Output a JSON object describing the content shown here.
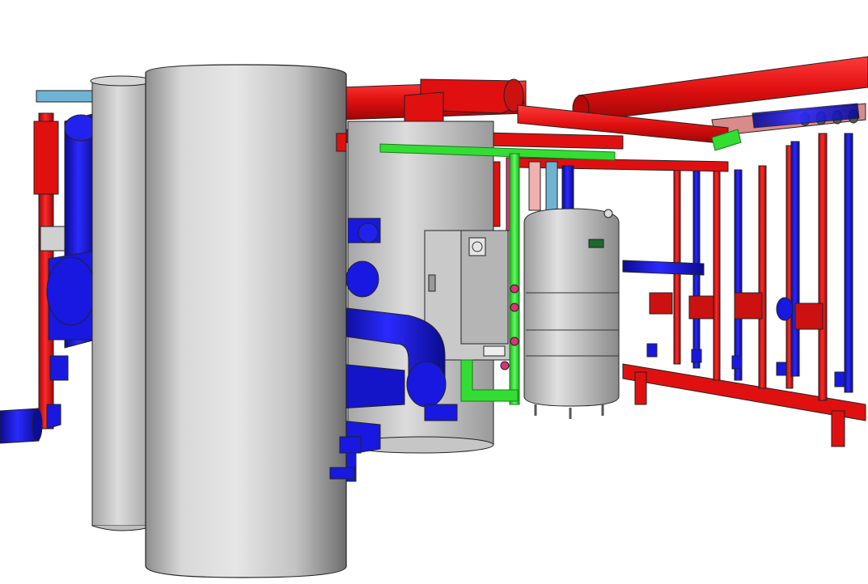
{
  "scene": {
    "description_free": true,
    "colors": {
      "background": "#ffffff",
      "supply_pipe": "#e01010",
      "supply_pipe_dark": "#b80808",
      "return_pipe": "#1818e0",
      "return_pipe_dark": "#0c0c9a",
      "glycol_pipe": "#33dd33",
      "cold_water_pipe": "#6fb3d3",
      "tank_light": "#e4e4e4",
      "tank_mid": "#bdbdbd",
      "tank_dark": "#8c8c8c",
      "pump_red": "#cc1111",
      "magenta": "#e0307a",
      "boiler_body": "#c9c9c9",
      "outline": "#222222"
    }
  }
}
